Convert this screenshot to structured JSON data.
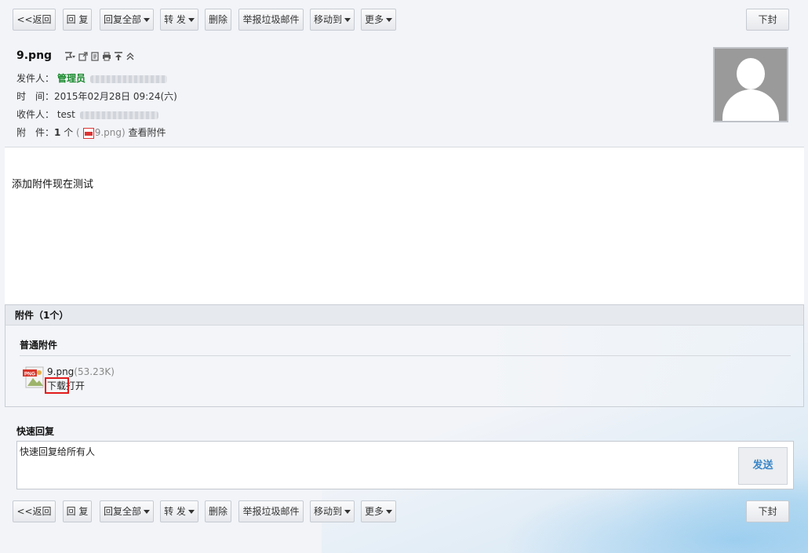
{
  "toolbar": {
    "back": "<<返回",
    "reply": "回 复",
    "reply_all": "回复全部",
    "forward": "转 发",
    "delete": "删除",
    "report_spam": "举报垃圾邮件",
    "move_to": "移动到",
    "more": "更多",
    "next": "下封"
  },
  "mail": {
    "subject": "9.png",
    "from_label": "发件人：",
    "from_name": "管理员",
    "time_label": "时　间：",
    "time_value": "2015年02月28日 09:24(六)",
    "to_label": "收件人：",
    "to_name": "test",
    "attach_label": "附　件：",
    "attach_count": "1",
    "attach_unit": "个",
    "attach_file_paren": "9.png)",
    "view_attach": "查看附件",
    "body": "添加附件现在测试"
  },
  "attachments": {
    "header": "附件（1个）",
    "section": "普通附件",
    "file_name": "9.png",
    "file_size": "(53.23K)",
    "download": "下载",
    "open": "打开"
  },
  "quick_reply": {
    "title": "快速回复",
    "placeholder": "快速回复给所有人",
    "send": "发送"
  },
  "icons": [
    "flag-icon",
    "popout-icon",
    "source-icon",
    "print-icon",
    "top-icon",
    "collapse-icon"
  ]
}
